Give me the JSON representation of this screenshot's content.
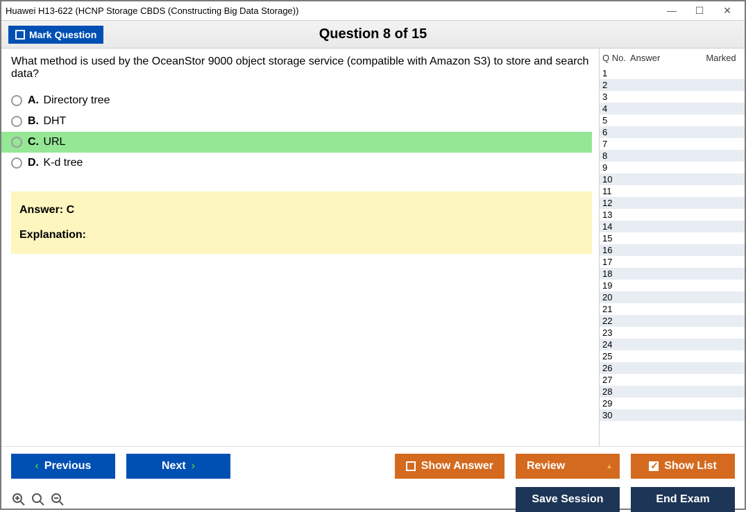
{
  "window": {
    "title": "Huawei H13-622 (HCNP Storage CBDS (Constructing Big Data Storage))"
  },
  "header": {
    "mark_label": "Mark Question",
    "counter": "Question 8 of 15"
  },
  "question": {
    "text": "What method is used by the OceanStor 9000 object storage service (compatible with Amazon S3) to store and search data?",
    "options": [
      {
        "letter": "A.",
        "text": "Directory tree",
        "highlight": false
      },
      {
        "letter": "B.",
        "text": "DHT",
        "highlight": false
      },
      {
        "letter": "C.",
        "text": "URL",
        "highlight": true
      },
      {
        "letter": "D.",
        "text": "K-d tree",
        "highlight": false
      }
    ],
    "answer_line": "Answer: C",
    "explanation_label": "Explanation:"
  },
  "sidebar": {
    "headers": {
      "qno": "Q No.",
      "answer": "Answer",
      "marked": "Marked"
    },
    "rows": [
      1,
      2,
      3,
      4,
      5,
      6,
      7,
      8,
      9,
      10,
      11,
      12,
      13,
      14,
      15,
      16,
      17,
      18,
      19,
      20,
      21,
      22,
      23,
      24,
      25,
      26,
      27,
      28,
      29,
      30
    ]
  },
  "buttons": {
    "previous": "Previous",
    "next": "Next",
    "show_answer": "Show Answer",
    "review": "Review",
    "show_list": "Show List",
    "save_session": "Save Session",
    "end_exam": "End Exam"
  }
}
